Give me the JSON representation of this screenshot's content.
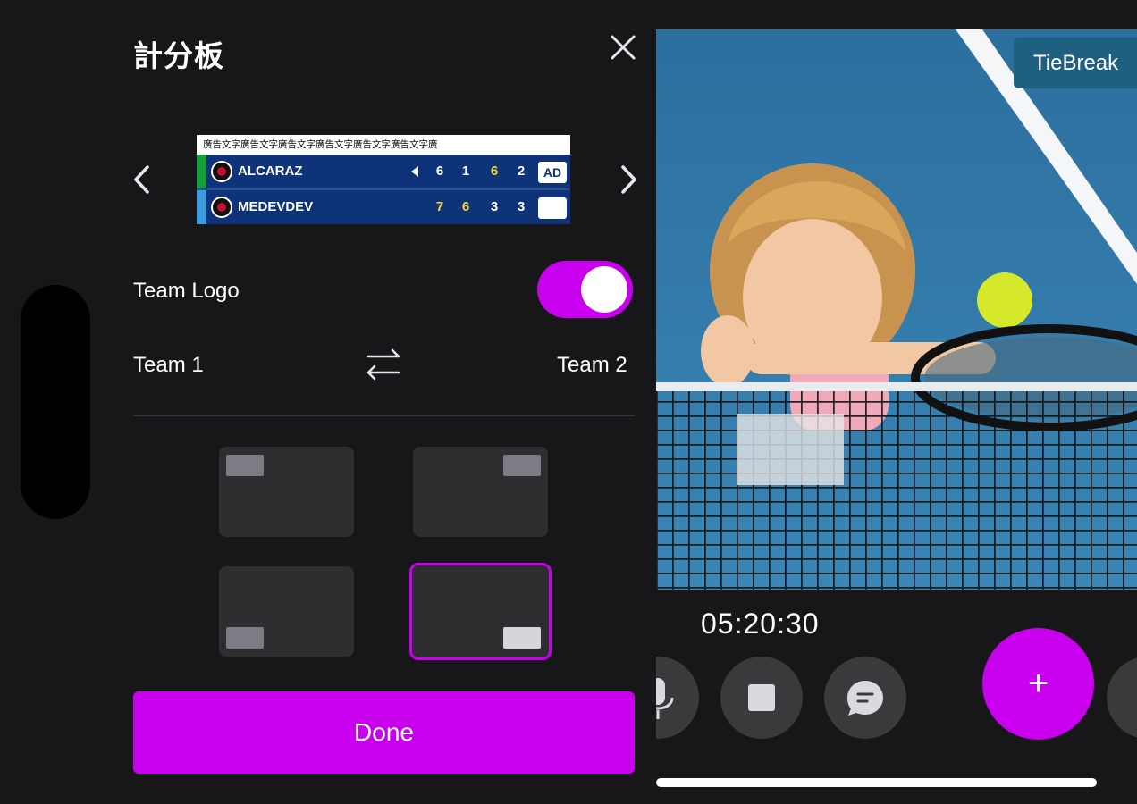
{
  "panel": {
    "title": "計分板"
  },
  "scoreboard": {
    "ad_text": "廣告文字廣告文字廣告文字廣告文字廣告文字廣告文字廣",
    "teams": [
      {
        "name": "ALCARAZ",
        "strip_color": "#169e3a",
        "scores": [
          "6",
          "1",
          "6",
          "2"
        ],
        "highlight": [
          false,
          false,
          true,
          false
        ],
        "point": "AD"
      },
      {
        "name": "MEDEVDEV",
        "strip_color": "#3d9ce0",
        "scores": [
          "7",
          "6",
          "3",
          "3"
        ],
        "highlight": [
          true,
          true,
          false,
          false
        ],
        "point": ""
      }
    ]
  },
  "options": {
    "team_logo_label": "Team Logo",
    "team_logo_enabled": true,
    "team1_label": "Team 1",
    "team2_label": "Team 2"
  },
  "positions": {
    "items": [
      "top-left",
      "top-right",
      "bottom-left",
      "bottom-right"
    ],
    "selected": "bottom-right"
  },
  "done_label": "Done",
  "video": {
    "tiebreak_label": "TieBreak",
    "timer": "05:20:30"
  },
  "controls": {
    "add_label": "+"
  },
  "colors": {
    "accent": "#c800ee",
    "background": "#17171a",
    "card": "#2e2e31",
    "scoreboard_bg": "#0e3378",
    "score_highlight": "#f5d33b"
  }
}
